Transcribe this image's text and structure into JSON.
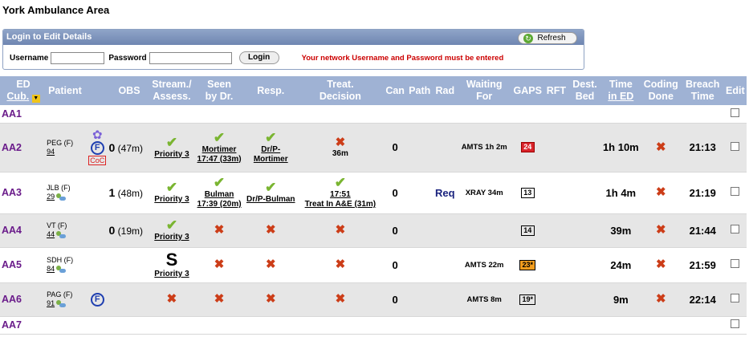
{
  "page_title": "York Ambulance Area",
  "login": {
    "header": "Login to Edit Details",
    "refresh": "Refresh",
    "username_label": "Username",
    "password_label": "Password",
    "login_button": "Login",
    "message": "Your network Username and Password must be entered"
  },
  "headers": {
    "cub_l1": "ED",
    "cub_l2": "Cub.",
    "patient": "Patient",
    "obs": "OBS",
    "stream_l1": "Stream./",
    "stream_l2": "Assess.",
    "seen_l1": "Seen",
    "seen_l2": "by Dr.",
    "resp": "Resp.",
    "treat_l1": "Treat.",
    "treat_l2": "Decision",
    "can": "Can",
    "path": "Path",
    "rad": "Rad",
    "waiting_l1": "Waiting",
    "waiting_l2": "For",
    "gaps": "GAPS",
    "rft": "RFT",
    "dest_l1": "Dest.",
    "dest_l2": "Bed",
    "time_l1": "Time",
    "time_l2": "in ED",
    "coding_l1": "Coding",
    "coding_l2": "Done",
    "breach_l1": "Breach",
    "breach_l2": "Time",
    "edit": "Edit"
  },
  "rows": [
    {
      "cub": "AA1"
    },
    {
      "cub": "AA2",
      "patient": "PEG (F)",
      "age": "94",
      "obs_num": "0",
      "obs_time": "(47m)",
      "flags": [
        "flower",
        "F",
        "CoC"
      ],
      "coc": "CoC",
      "fflag": "F",
      "stream": "Priority 3",
      "seen_name": "Mortimer",
      "seen_time": "17:47 (33m)",
      "resp": "Dr/P-Mortimer",
      "treat_text": "36m",
      "can": "0",
      "rad": "",
      "waiting": "AMTS 1h 2m",
      "gaps": "24",
      "gaps_style": "red",
      "time": "1h 10m",
      "breach": "21:13"
    },
    {
      "cub": "AA3",
      "patient": "JLB (F)",
      "age": "29",
      "obs_num": "1",
      "obs_time": "(48m)",
      "stream": "Priority 3",
      "seen_name": "Bulman",
      "seen_time": "17:39 (20m)",
      "resp": "Dr/P-Bulman",
      "treat_time": "17:51",
      "treat_text": "Treat In A&E (31m)",
      "can": "0",
      "rad": "Req",
      "waiting": "XRAY 34m",
      "gaps": "13",
      "time": "1h 4m",
      "breach": "21:19"
    },
    {
      "cub": "AA4",
      "patient": "VT (F)",
      "age": "44",
      "obs_num": "0",
      "obs_time": "(19m)",
      "stream": "Priority 3",
      "can": "0",
      "gaps": "14",
      "time": "39m",
      "breach": "21:44"
    },
    {
      "cub": "AA5",
      "patient": "SDH (F)",
      "age": "84",
      "stream_big": "S",
      "stream": "Priority 3",
      "can": "0",
      "waiting": "AMTS 22m",
      "gaps": "23*",
      "gaps_style": "orange",
      "time": "24m",
      "breach": "21:59"
    },
    {
      "cub": "AA6",
      "patient": "PAG (F)",
      "age": "91",
      "fflag": "F",
      "can": "0",
      "waiting": "AMTS 8m",
      "gaps": "19*",
      "time": "9m",
      "breach": "22:14"
    },
    {
      "cub": "AA7"
    }
  ],
  "colors": {
    "header_bg": "#9fb2d4",
    "cub_text": "#6a1b8a",
    "cross": "#cc3d18",
    "tick": "#7ab531",
    "gaps_red": "#d9232a",
    "gaps_orange": "#f29d1e"
  }
}
